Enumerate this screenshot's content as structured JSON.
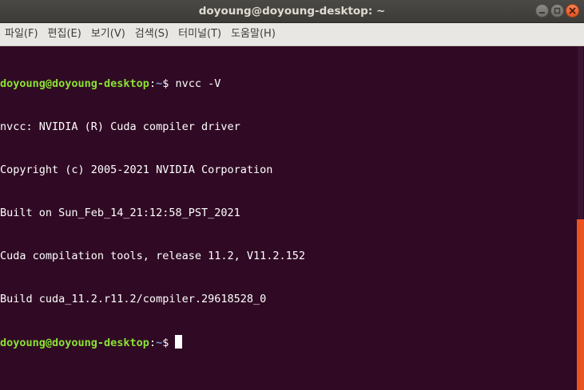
{
  "window": {
    "title": "doyoung@doyoung-desktop: ~",
    "buttons": {
      "minimize": "minimize",
      "maximize": "maximize",
      "close": "close"
    }
  },
  "menu": [
    {
      "label": "파일(F)"
    },
    {
      "label": "편집(E)"
    },
    {
      "label": "보기(V)"
    },
    {
      "label": "검색(S)"
    },
    {
      "label": "터미널(T)"
    },
    {
      "label": "도움말(H)"
    }
  ],
  "terminal": {
    "prompt_user": "doyoung@doyoung-desktop",
    "prompt_sep": ":",
    "prompt_path": "~",
    "prompt_sign": "$ ",
    "command": "nvcc -V",
    "output": [
      "nvcc: NVIDIA (R) Cuda compiler driver",
      "Copyright (c) 2005-2021 NVIDIA Corporation",
      "Built on Sun_Feb_14_21:12:58_PST_2021",
      "Cuda compilation tools, release 11.2, V11.2.152",
      "Build cuda_11.2.r11.2/compiler.29618528_0"
    ]
  },
  "colors": {
    "background": "#300a24",
    "prompt_user": "#8ae234",
    "prompt_path": "#729fcf",
    "scroll_thumb": "#e95420"
  }
}
